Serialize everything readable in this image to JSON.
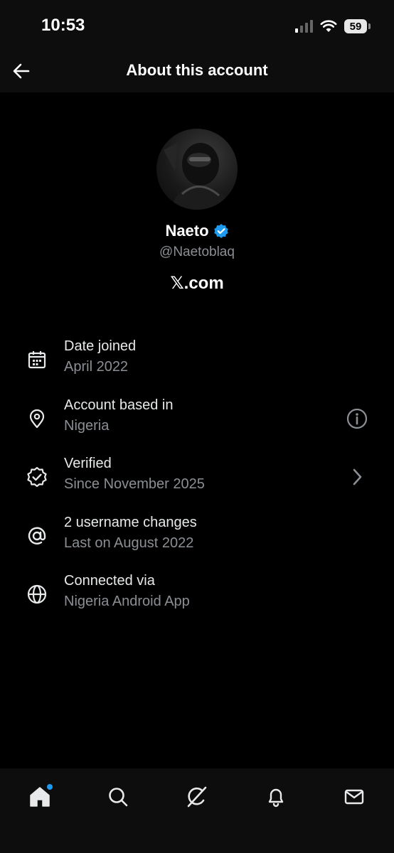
{
  "status_bar": {
    "time": "10:53",
    "battery": "59"
  },
  "header": {
    "title": "About this account"
  },
  "profile": {
    "name": "Naeto",
    "handle": "@Naetoblaq",
    "site": "𝕏.com"
  },
  "rows": [
    {
      "icon": "calendar-icon",
      "title": "Date joined",
      "subtitle": "April 2022"
    },
    {
      "icon": "location-pin-icon",
      "title": "Account based in",
      "subtitle": "Nigeria",
      "trailing": "info-icon"
    },
    {
      "icon": "verified-badge-outline-icon",
      "title": "Verified",
      "subtitle": "Since November 2025",
      "trailing": "chevron-right-icon"
    },
    {
      "icon": "at-sign-icon",
      "title": "2 username changes",
      "subtitle": "Last on August 2022"
    },
    {
      "icon": "globe-icon",
      "title": "Connected via",
      "subtitle": "Nigeria Android App"
    }
  ],
  "tabbar": {
    "items": [
      "home-icon",
      "search-icon",
      "grok-icon",
      "notifications-icon",
      "messages-icon"
    ]
  },
  "colors": {
    "background": "#000000",
    "accent": "#1d9bf0",
    "muted_text": "#8b8f94"
  }
}
